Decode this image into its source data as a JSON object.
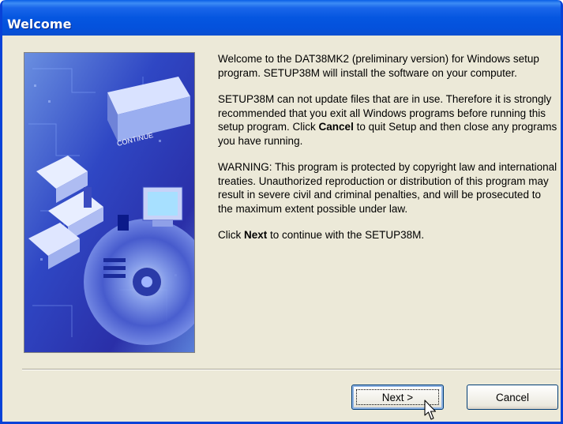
{
  "window": {
    "title": "Welcome"
  },
  "content": {
    "para1": "Welcome to the DAT38MK2 (preliminary version) for Windows setup program.  SETUP38M will install the software on your computer.",
    "para2_a": "SETUP38M can not update files that are in use.  Therefore it is strongly recommended that you exit all Windows programs before running this setup program.  Click ",
    "para2_bold": "Cancel",
    "para2_b": " to quit Setup and then close any programs you have running.",
    "para3": "WARNING:  This program is protected by copyright law and international treaties.  Unauthorized reproduction or distribution of this program may result in severe civil and criminal penalties, and will be prosecuted to the maximum extent possible under law.",
    "para4_a": "Click ",
    "para4_bold": "Next",
    "para4_b": " to continue with the SETUP38M."
  },
  "buttons": {
    "next": "Next >",
    "cancel": "Cancel"
  },
  "image": {
    "label": "CONTINUE"
  },
  "colors": {
    "titlebar": "#0556e0",
    "dialog_bg": "#ece9d8",
    "button_border": "#003c74"
  }
}
